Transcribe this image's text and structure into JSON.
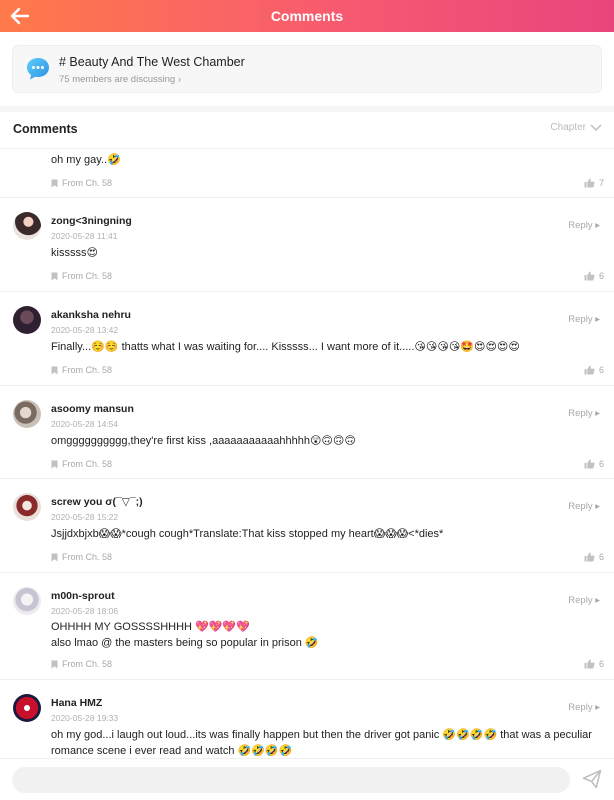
{
  "header": {
    "title": "Comments"
  },
  "discussion": {
    "title": "# Beauty And The West Chamber",
    "subtitle": "75 members are discussing"
  },
  "comments_section": {
    "heading": "Comments",
    "filter_label": "Chapter"
  },
  "comments": [
    {
      "user": "",
      "date": "",
      "text": [
        "oh my gay..🤣"
      ],
      "chapter": "From Ch. 58",
      "likes": "7",
      "reply_label": ""
    },
    {
      "user": "zong<3ningning",
      "date": "2020-05-28 11:41",
      "text": [
        "kisssss😍"
      ],
      "chapter": "From Ch. 58",
      "likes": "6",
      "reply_label": "Reply"
    },
    {
      "user": "akanksha nehru",
      "date": "2020-05-28 13:42",
      "text": [
        "Finally...☺️☺️ thatts what I was waiting for....  Kisssss... I want more of it.....😘😘😘😘🤩😍😍😍😍"
      ],
      "chapter": "From Ch. 58",
      "likes": "6",
      "reply_label": "Reply"
    },
    {
      "user": "asoomy mansun",
      "date": "2020-05-28 14:54",
      "text": [
        "omgggggggggg,they're first kiss ,aaaaaaaaaaahhhhh😲🙃🙃🙃"
      ],
      "chapter": "From Ch. 58",
      "likes": "6",
      "reply_label": "Reply"
    },
    {
      "user": "screw you σ(¯▽¯;)",
      "date": "2020-05-28 15:22",
      "text": [
        "Jsjjdxbjxb😱😱*cough cough*Translate:That kiss stopped my heart😱😱😱<*dies*"
      ],
      "chapter": "From Ch. 58",
      "likes": "6",
      "reply_label": "Reply"
    },
    {
      "user": "m00n-sprout",
      "date": "2020-05-28 18:06",
      "text": [
        "OHHHH MY GOSSSSHHHH 💖💖💖💖",
        "also lmao @ the masters being so popular in prison 🤣"
      ],
      "chapter": "From Ch. 58",
      "likes": "6",
      "reply_label": "Reply"
    },
    {
      "user": "Hana HMZ",
      "date": "2020-05-28 19:33",
      "text": [
        "oh my god...i laugh out loud...its was finally happen but then the driver got panic 🤣🤣🤣🤣 that was a peculiar romance scene i ever read and watch 🤣🤣🤣🤣"
      ],
      "chapter": "",
      "likes": "",
      "reply_label": "Reply"
    }
  ],
  "footer": {
    "input_placeholder": ""
  },
  "colors": {
    "header_start": "#ff7a4a",
    "header_end": "#e9457d",
    "muted": "#a8a8a8"
  },
  "icons": {
    "back": "arrow-left-icon",
    "chat": "chat-bubble-icon",
    "send": "paper-plane-icon",
    "like": "thumbs-up-icon",
    "bookmark": "bookmark-icon"
  }
}
